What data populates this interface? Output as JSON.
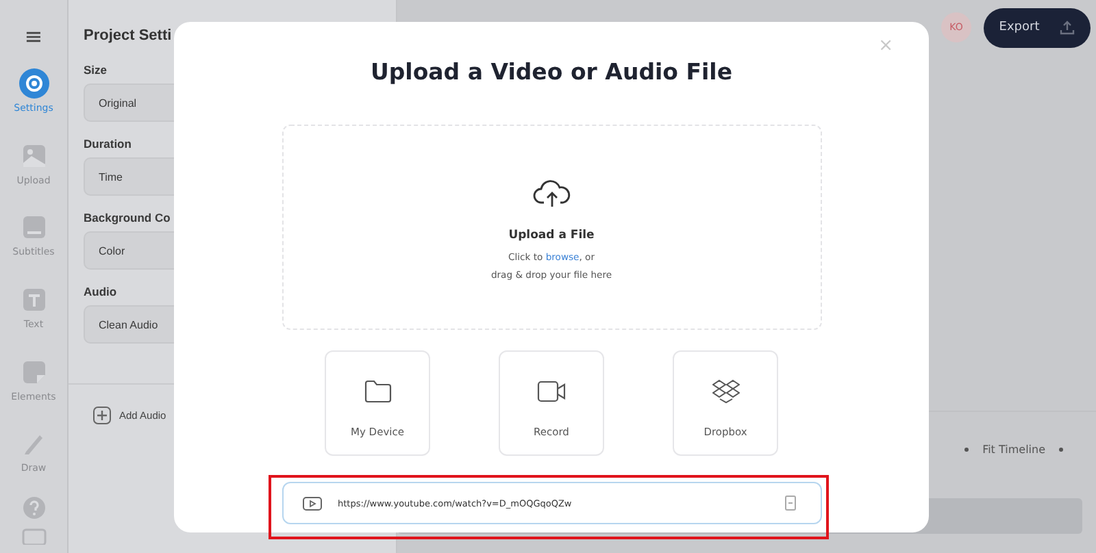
{
  "sidebar": {
    "menu": "≡",
    "items": [
      {
        "label": "Settings",
        "selected": true
      },
      {
        "label": "Upload",
        "selected": false
      },
      {
        "label": "Subtitles",
        "selected": false
      },
      {
        "label": "Text",
        "selected": false
      },
      {
        "label": "Elements",
        "selected": false
      },
      {
        "label": "Draw",
        "selected": false
      }
    ]
  },
  "settings_panel": {
    "title": "Project Setti",
    "sections": [
      {
        "label": "Size",
        "value": "Original"
      },
      {
        "label": "Duration",
        "value": "Time"
      },
      {
        "label": "Background Co",
        "value": "Color"
      },
      {
        "label": "Audio",
        "value": "Clean Audio"
      }
    ],
    "add_audio": "Add Audio"
  },
  "top_bar": {
    "avatar": "KO",
    "export": "Export"
  },
  "timeline": {
    "fit": "Fit Timeline"
  },
  "modal": {
    "title": "Upload a Video or Audio File",
    "close": "×",
    "dropzone": {
      "title": "Upload a File",
      "prefix": "Click to ",
      "link": "browse",
      "suffix": ", or",
      "line2": "drag & drop your file here"
    },
    "sources": [
      {
        "label": "My Device"
      },
      {
        "label": "Record"
      },
      {
        "label": "Dropbox"
      }
    ],
    "url_field": {
      "value": "https://www.youtube.com/watch?v=D_mOQGqoQZw"
    }
  }
}
